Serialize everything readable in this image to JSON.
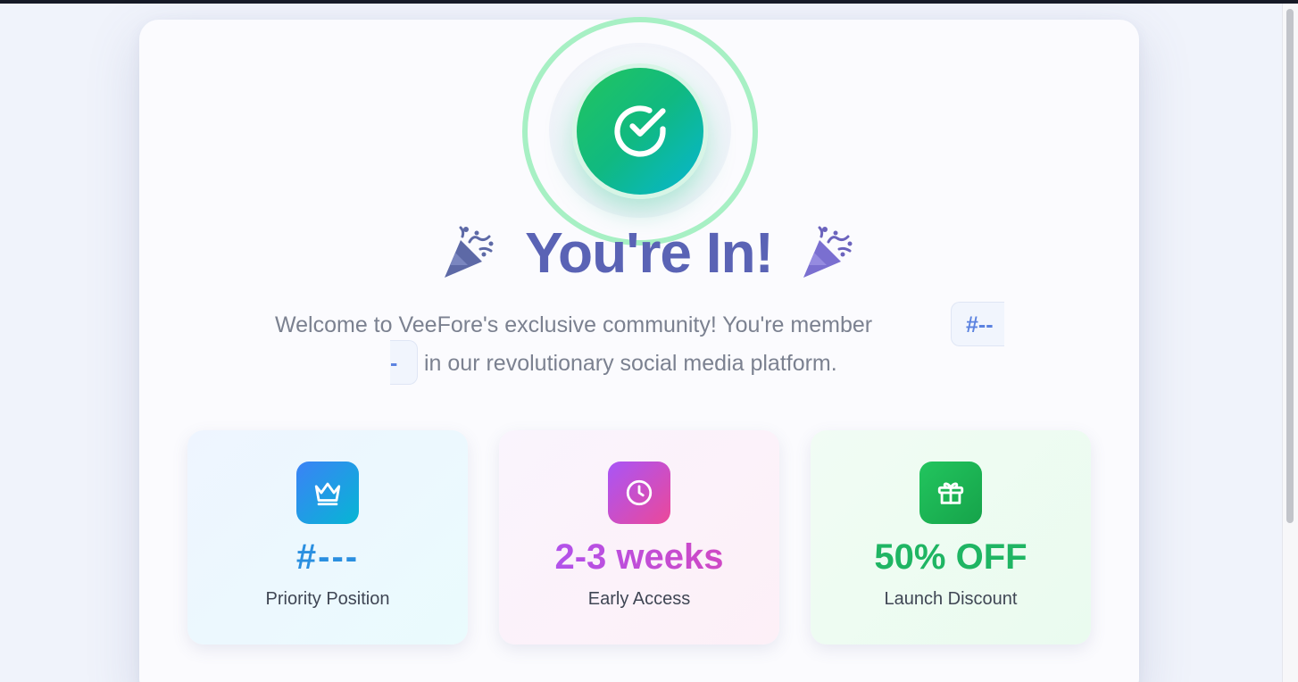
{
  "hero": {
    "title": "You're In!",
    "welcome_line1": "Welcome to VeeFore's exclusive community! You're member",
    "member_badge_part1": "#--",
    "member_badge_part2": "-",
    "welcome_line2": "in our revolutionary social media platform.",
    "colors": {
      "title": "#5a63b5",
      "check_gradient": [
        "#22c55e",
        "#06b6d4"
      ],
      "ring": "#a7f0c4"
    }
  },
  "features": [
    {
      "icon": "crown-icon",
      "value": "#---",
      "label": "Priority Position",
      "accent": "#2a8fe0"
    },
    {
      "icon": "clock-icon",
      "value": "2-3 weeks",
      "label": "Early Access",
      "accent": "#b44fe0"
    },
    {
      "icon": "gift-icon",
      "value": "50% OFF",
      "label": "Launch Discount",
      "accent": "#1fb563"
    }
  ]
}
